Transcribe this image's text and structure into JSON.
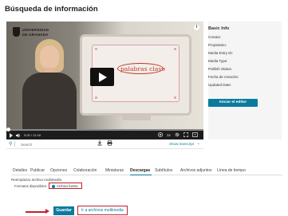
{
  "page": {
    "title": "Búsqueda de información"
  },
  "player": {
    "logo_line1": "UNIVERSIDAD",
    "logo_line2": "DE GRANADA",
    "slide_text": "palabras clave",
    "info_icon": "info-icon",
    "play_icon": "play-icon",
    "time": "0:00 / 11:18",
    "speed": "1x",
    "progress": 0.01
  },
  "search": {
    "placeholder": "Search",
    "show_transcript": "Show transcript"
  },
  "info": {
    "title": "Basic Info",
    "fields": [
      "Creator:",
      "Propietario:",
      "Media Entry ID:",
      "Media Type:",
      "Publish Status:",
      "Fecha de creación:",
      "Updated Date:"
    ],
    "editor_button": "Iniciar el editor"
  },
  "tabs": [
    "Detalles",
    "Publicar",
    "Opciones",
    "Colaboración",
    "Miniaturas",
    "Descargas",
    "Subtítulos",
    "Archivos adjuntos",
    "Línea de tiempo"
  ],
  "active_tab": "Descargas",
  "downloads": {
    "replace_label": "Reemplazar archivo multimedia",
    "formats_label": "Formatos disponibles:",
    "option_label": "Archivo fuente"
  },
  "actions": {
    "save": "Guardar",
    "goto": "Ir a archivos multimedia"
  },
  "colors": {
    "accent": "#0a7b9e",
    "highlight": "#c2202e"
  }
}
